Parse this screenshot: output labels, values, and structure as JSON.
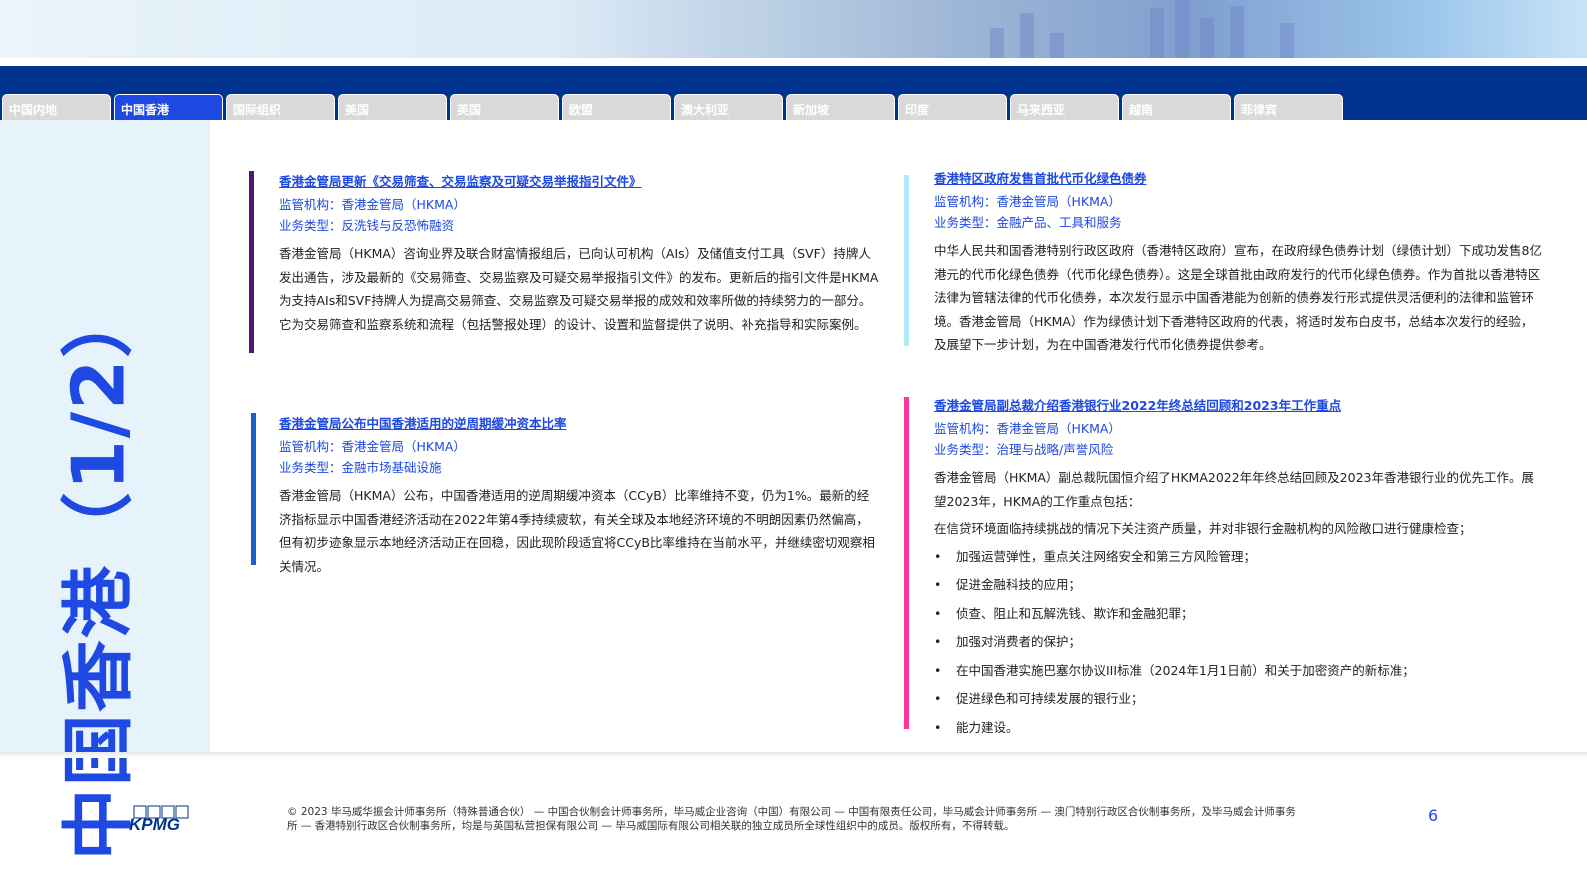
{
  "tabs": [
    "中国内地",
    "中国香港",
    "国际组织",
    "美国",
    "英国",
    "欧盟",
    "澳大利亚",
    "新加坡",
    "印度",
    "马来西亚",
    "越南",
    "菲律宾"
  ],
  "active_tab": 1,
  "side_title": "中国香港（1/2）",
  "articles": [
    {
      "title": "香港金管局更新《交易筛查、交易监察及可疑交易举报指引文件》",
      "regulator": "监管机构：香港金管局（HKMA）",
      "type": "业务类型：反洗钱与反恐怖融资",
      "body": "香港金管局（HKMA）咨询业界及联合财富情报组后，已向认可机构（AIs）及储值支付工具（SVF）持牌人发出通告，涉及最新的《交易筛查、交易监察及可疑交易举报指引文件》的发布。更新后的指引文件是HKMA为支持AIs和SVF持牌人为提高交易筛查、交易监察及可疑交易举报的成效和效率所做的持续努力的一部分。它为交易筛查和监察系统和流程（包括警报处理）的设计、设置和监督提供了说明、补充指导和实际案例。",
      "color": "#4b1a6e"
    },
    {
      "title": "香港金管局公布中国香港适用的逆周期缓冲资本比率",
      "regulator": "监管机构：香港金管局（HKMA）",
      "type": "业务类型：金融市场基础设施",
      "body": "香港金管局（HKMA）公布，中国香港适用的逆周期缓冲资本（CCyB）比率维持不变，仍为1%。最新的经济指标显示中国香港经济活动在2022年第4季持续疲软，有关全球及本地经济环境的不明朗因素仍然偏高，但有初步迹象显示本地经济活动正在回稳，因此现阶段适宜将CCyB比率维持在当前水平，并继续密切观察相关情况。",
      "color": "#1e5fcc"
    },
    {
      "title": "香港特区政府发售首批代币化绿色债券",
      "regulator": "监管机构：香港金管局（HKMA）",
      "type": "业务类型：金融产品、工具和服务",
      "body": "中华人民共和国香港特别行政区政府（香港特区政府）宣布，在政府绿色债券计划（绿债计划）下成功发售8亿港元的代币化绿色债券（代币化绿色债券）。这是全球首批由政府发行的代币化绿色债券。作为首批以香港特区法律为管辖法律的代币化债券，本次发行显示中国香港能为创新的债券发行形式提供灵活便利的法律和监管环境。香港金管局（HKMA）作为绿债计划下香港特区政府的代表，将适时发布白皮书，总结本次发行的经验，及展望下一步计划，为在中国香港发行代币化债券提供参考。",
      "color": "#b3eaf8"
    },
    {
      "title": "香港金管局副总裁介绍香港银行业2022年终总结回顾和2023年工作重点",
      "regulator": "监管机构：香港金管局（HKMA）",
      "type": "业务类型：治理与战略/声誉风险",
      "body": "香港金管局（HKMA）副总裁阮国恒介绍了HKMA2022年年终总结回顾及2023年香港银行业的优先工作。展望2023年，HKMA的工作重点包括：",
      "intro": "在信贷环境面临持续挑战的情况下关注资产质量，并对非银行金融机构的风险敞口进行健康检查；",
      "bullets": [
        "加强运营弹性，重点关注网络安全和第三方风险管理；",
        "促进金融科技的应用；",
        "侦查、阻止和瓦解洗钱、欺诈和金融犯罪；",
        "加强对消费者的保护；",
        "在中国香港实施巴塞尔协议III标准（2024年1月1日前）和关于加密资产的新标准；",
        "促进绿色和可持续发展的银行业；",
        "能力建设。"
      ],
      "color": "#ff3399"
    }
  ],
  "footer": "© 2023 毕马威华振会计师事务所（特殊普通合伙） — 中国合伙制会计师事务所，毕马威企业咨询（中国）有限公司 — 中国有限责任公司，毕马威会计师事务所 — 澳门特别行政区合伙制事务所，及毕马威会计师事务所 — 香港特别行政区合伙制事务所，均是与英国私营担保有限公司 — 毕马威国际有限公司相关联的独立成员所全球性组织中的成员。版权所有，不得转载。",
  "logo_text": "KPMG",
  "page_number": "6"
}
